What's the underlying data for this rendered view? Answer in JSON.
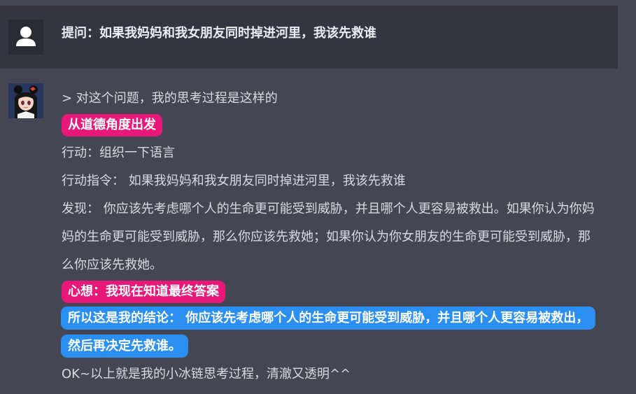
{
  "question": {
    "text": "提问：如果我妈妈和我女朋友同时掉进河里，我该先救谁"
  },
  "answer": {
    "intro": "> 对这个问题，我的思考过程是这样的",
    "tag_start": "从道德角度出发",
    "action": "行动：组织一下语言",
    "instruction": "行动指令： 如果我妈妈和我女朋友同时掉进河里，我该先救谁",
    "finding": "发现： 你应该先考虑哪个人的生命更可能受到威胁，并且哪个人更容易被救出。如果你认为你妈妈的生命更可能受到威胁，那么你应该先救她；如果你认为你女朋友的生命更可能受到威胁，那么你应该先救她。",
    "tag_thought": "心想：我现在知道最终答案",
    "conclusion": "所以这是我的结论： 你应该先考虑哪个人的生命更可能受到威胁，并且哪个人更容易被救出，然后再决定先救谁。",
    "outro": "OK~以上就是我的小冰链思考过程，清澈又透明^^"
  },
  "colors": {
    "page_bg": "#444654",
    "question_bg": "#343541",
    "text": "#d9d9e3",
    "tag_pink": "#e8187a",
    "tag_blue": "#2b8ff2"
  },
  "icons": {
    "user_avatar": "user-silhouette-icon",
    "bot_avatar": "anime-girl-avatar"
  }
}
